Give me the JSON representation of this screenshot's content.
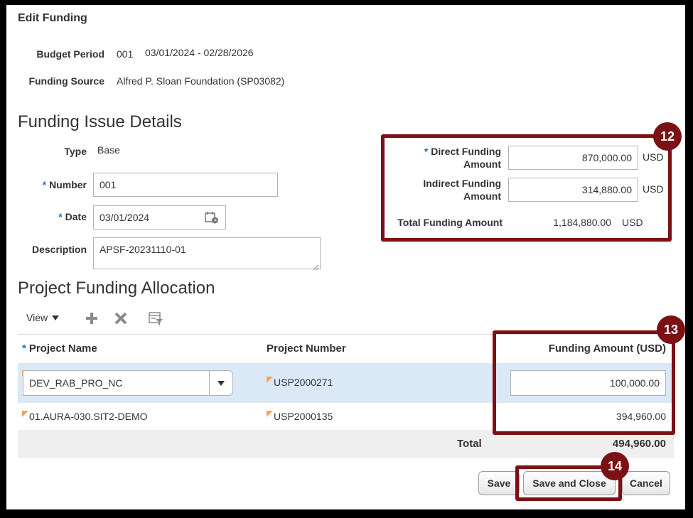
{
  "page": {
    "title": "Edit Funding"
  },
  "budget_period": {
    "label": "Budget Period",
    "number": "001",
    "range": "03/01/2024 - 02/28/2026"
  },
  "funding_source": {
    "label": "Funding Source",
    "value": "Alfred P. Sloan Foundation (SP03082)"
  },
  "issue_details": {
    "heading": "Funding Issue Details",
    "type_label": "Type",
    "type_value": "Base",
    "number_label": "Number",
    "number_value": "001",
    "date_label": "Date",
    "date_value": "03/01/2024",
    "description_label": "Description",
    "description_value": "APSF-20231110-01"
  },
  "amounts": {
    "direct_label_1": "Direct Funding",
    "direct_label_2": "Amount",
    "direct_value": "870,000.00",
    "indirect_label_1": "Indirect Funding",
    "indirect_label_2": "Amount",
    "indirect_value": "314,880.00",
    "total_label": "Total Funding Amount",
    "total_value": "1,184,880.00",
    "currency": "USD"
  },
  "allocation": {
    "heading": "Project Funding Allocation",
    "view_label": "View",
    "columns": {
      "project_name": "Project Name",
      "project_number": "Project Number",
      "funding_amount": "Funding Amount (USD)"
    },
    "rows": [
      {
        "project_name": "DEV_RAB_PRO_NC",
        "project_number": "USP2000271",
        "funding_amount": "100,000.00"
      },
      {
        "project_name": "01.AURA-030.SIT2-DEMO",
        "project_number": "USP2000135",
        "funding_amount": "394,960.00"
      }
    ],
    "total_label": "Total",
    "total_value": "494,960.00"
  },
  "buttons": {
    "save": "Save",
    "save_close": "Save and Close",
    "cancel": "Cancel"
  },
  "callouts": {
    "c12": "12",
    "c13": "13",
    "c14": "14"
  },
  "colors": {
    "callout": "#7b1114",
    "required": "#1f6fc5",
    "selected_row": "#dbe9f7"
  }
}
